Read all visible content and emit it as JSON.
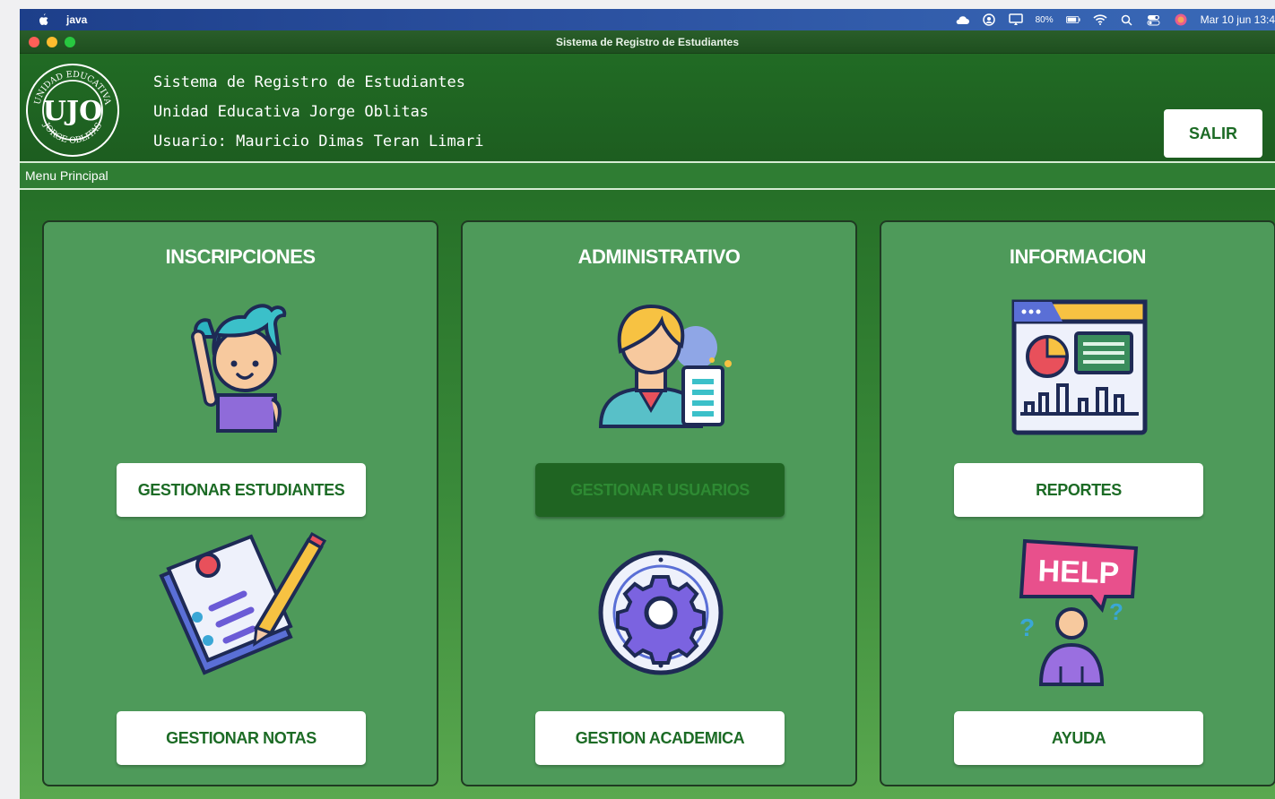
{
  "menubar": {
    "app_name": "java",
    "battery": "80%",
    "clock": "Mar 10 jun  13:4"
  },
  "window": {
    "title": "Sistema de Registro de Estudiantes"
  },
  "header": {
    "line1": "Sistema de Registro de Estudiantes",
    "line2": "Unidad Educativa Jorge Oblitas",
    "line3": "Usuario: Mauricio Dimas Teran Limari",
    "logout_label": "SALIR",
    "logo_text_top": "UNIDAD EDUCATIVA",
    "logo_text_bottom": "JORGE OBLITAS",
    "logo_monogram": "UJO"
  },
  "menu_label": "Menu Principal",
  "panels": [
    {
      "title": "INSCRIPCIONES",
      "buttons": [
        {
          "label": "GESTIONAR ESTUDIANTES",
          "enabled": true,
          "icon": "student-raising-hand-icon"
        },
        {
          "label": "GESTIONAR NOTAS",
          "enabled": true,
          "icon": "notes-pencil-icon"
        }
      ]
    },
    {
      "title": "ADMINISTRATIVO",
      "buttons": [
        {
          "label": "GESTIONAR USUARIOS",
          "enabled": false,
          "icon": "admin-user-icon"
        },
        {
          "label": "GESTION ACADEMICA",
          "enabled": true,
          "icon": "gear-icon"
        }
      ]
    },
    {
      "title": "INFORMACION",
      "buttons": [
        {
          "label": "REPORTES",
          "enabled": true,
          "icon": "report-dashboard-icon"
        },
        {
          "label": "AYUDA",
          "enabled": true,
          "icon": "help-person-icon"
        }
      ]
    }
  ],
  "help_sign_text": "HELP",
  "colors": {
    "accent": "#1c6b25",
    "panel": "#4e9a5a",
    "header": "#216b24"
  }
}
